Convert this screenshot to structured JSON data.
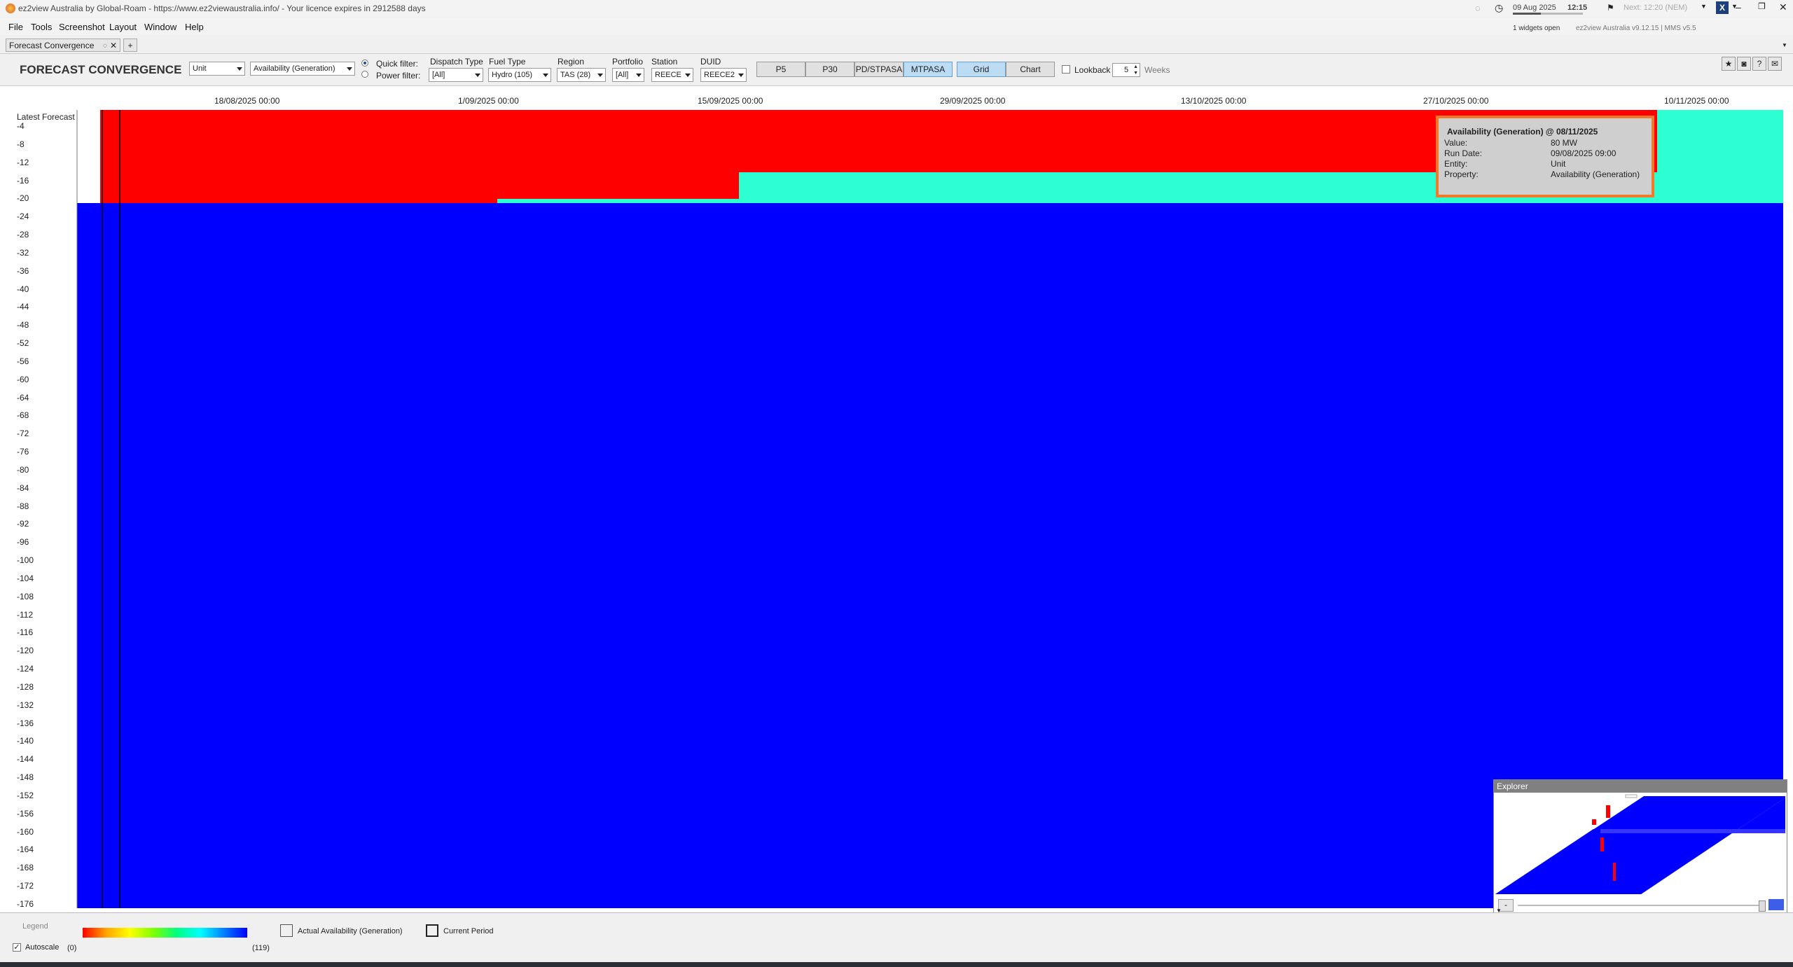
{
  "window": {
    "title": "ez2view Australia by Global-Roam - https://www.ez2viewaustralia.info/ - Your licence expires in 2912588 days",
    "date": "09 Aug 2025",
    "time": "12:15",
    "next": "Next: 12:20 (NEM)",
    "widgets_open": "1 widgets open",
    "version": "ez2view Australia v9.12.15 | MMS v5.5"
  },
  "menu": {
    "file": "File",
    "tools": "Tools",
    "screenshot": "Screenshot",
    "layout": "Layout",
    "window": "Window",
    "help": "Help"
  },
  "tabs": {
    "active": "Forecast Convergence",
    "add": "+"
  },
  "toolbar": {
    "title": "FORECAST CONVERGENCE",
    "entity_select": "Unit",
    "property_select": "Availability (Generation)",
    "quick_filter": "Quick filter:",
    "power_filter": "Power filter:",
    "dispatch_type_label": "Dispatch Type",
    "dispatch_type_value": "[All]",
    "fuel_type_label": "Fuel Type",
    "fuel_type_value": "Hydro (105)",
    "region_label": "Region",
    "region_value": "TAS (28)",
    "portfolio_label": "Portfolio",
    "portfolio_value": "[All]",
    "station_label": "Station",
    "station_value": "REECE",
    "duid_label": "DUID",
    "duid_value": "REECE2",
    "p5": "P5",
    "p30": "P30",
    "pdstpasa": "PD/STPASA",
    "mtpasa": "MTPASA",
    "grid": "Grid",
    "chart": "Chart",
    "lookback": "Lookback",
    "lookback_value": "5",
    "weeks": "Weeks"
  },
  "axis": {
    "x_ticks": [
      "18/08/2025 00:00",
      "1/09/2025 00:00",
      "15/09/2025 00:00",
      "29/09/2025 00:00",
      "13/10/2025 00:00",
      "27/10/2025 00:00",
      "10/11/2025 00:00"
    ],
    "y_header": "Latest Forecast",
    "y_ticks": [
      "-4",
      "-8",
      "-12",
      "-16",
      "-20",
      "-24",
      "-28",
      "-32",
      "-36",
      "-40",
      "-44",
      "-48",
      "-52",
      "-56",
      "-60",
      "-64",
      "-68",
      "-72",
      "-76",
      "-80",
      "-84",
      "-88",
      "-92",
      "-96",
      "-100",
      "-104",
      "-108",
      "-112",
      "-116",
      "-120",
      "-124",
      "-128",
      "-132",
      "-136",
      "-140",
      "-144",
      "-148",
      "-152",
      "-156",
      "-160",
      "-164",
      "-168",
      "-172",
      "-176"
    ]
  },
  "tooltip": {
    "title": "Availability (Generation) @ 08/11/2025",
    "value_label": "Value:",
    "value": "80 MW",
    "run_date_label": "Run Date:",
    "run_date": "09/08/2025 09:00",
    "entity_label": "Entity:",
    "entity": "Unit",
    "property_label": "Property:",
    "property": "Availability (Generation)"
  },
  "explorer": {
    "title": "Explorer",
    "minus": "-"
  },
  "legend": {
    "title": "Legend",
    "autoscale": "Autoscale",
    "min": "(0)",
    "max": "(119)",
    "actual": "Actual Availability (Generation)",
    "current_period": "Current Period"
  },
  "colors": {
    "red": "#ff0000",
    "cyan": "#2dffd2",
    "blue": "#0000ff",
    "tooltip_border": "#f07a2a",
    "accent": "#bcdcf4"
  }
}
